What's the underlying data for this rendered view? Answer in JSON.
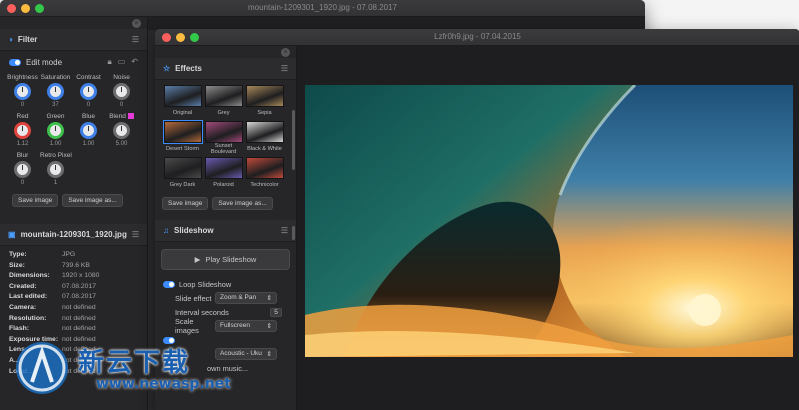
{
  "back_window": {
    "title": "mountain-1209301_1920.jpg - 07.08.2017",
    "filter": {
      "heading": "Filter",
      "edit_mode_label": "Edit mode",
      "knobs_row1": [
        {
          "label": "Brightness",
          "value": "0"
        },
        {
          "label": "Saturation",
          "value": "37"
        },
        {
          "label": "Contrast",
          "value": "0"
        },
        {
          "label": "Noise",
          "value": "0"
        }
      ],
      "knobs_row2": [
        {
          "label": "Red",
          "value": "1.12"
        },
        {
          "label": "Green",
          "value": "1.00"
        },
        {
          "label": "Blue",
          "value": "1.00"
        },
        {
          "label": "Blend",
          "value": "5.00"
        }
      ],
      "knobs_row3": [
        {
          "label": "Blur",
          "value": "0"
        },
        {
          "label": "Retro Pixel",
          "value": "1"
        }
      ],
      "save_image": "Save image",
      "save_image_as": "Save image as..."
    },
    "file_info": {
      "heading": "mountain-1209301_1920.jpg",
      "rows": [
        {
          "k": "Type:",
          "v": "JPG"
        },
        {
          "k": "Size:",
          "v": "739.6 KB"
        },
        {
          "k": "Dimensions:",
          "v": "1920 x 1080"
        },
        {
          "k": "Created:",
          "v": "07.08.2017"
        },
        {
          "k": "Last edited:",
          "v": "07.08.2017"
        },
        {
          "k": "Camera:",
          "v": "not defined"
        },
        {
          "k": "Resolution:",
          "v": "not defined"
        },
        {
          "k": "Flash:",
          "v": "not defined"
        },
        {
          "k": "Exposure time:",
          "v": "not defined"
        },
        {
          "k": "Lens:",
          "v": "not defined"
        },
        {
          "k": "A...",
          "v": "not defined"
        },
        {
          "k": "Locat...",
          "v": "not defined"
        }
      ]
    }
  },
  "front_window": {
    "title": "Lzfr0h9.jpg - 07.04.2015",
    "effects": {
      "heading": "Effects",
      "items": [
        {
          "label": "Original",
          "tint": "#5a7ea8"
        },
        {
          "label": "Grey",
          "tint": "#8c8c8c"
        },
        {
          "label": "Sepia",
          "tint": "#a8895a"
        },
        {
          "label": "Desert Storm",
          "tint": "#b36a3a"
        },
        {
          "label": "Sunset Boulevard",
          "tint": "#a24a7a"
        },
        {
          "label": "Black & White",
          "tint": "#d8d8d8"
        },
        {
          "label": "Grey Dark",
          "tint": "#4a4a4a"
        },
        {
          "label": "Polaroid",
          "tint": "#6a5ab0"
        },
        {
          "label": "Technicolor",
          "tint": "#c04a3a"
        }
      ],
      "save_image": "Save image",
      "save_image_as": "Save image as..."
    },
    "slideshow": {
      "heading": "Slideshow",
      "play_label": "Play Slideshow",
      "loop_label": "Loop Slideshow",
      "slide_effect_label": "Slide effect",
      "slide_effect_value": "Zoom & Pan",
      "interval_label": "Interval seconds",
      "interval_value": "5",
      "scale_label": "Scale images",
      "scale_value": "Fullscreen",
      "music_value": "Acoustic - Uku",
      "own_music_label": "own music..."
    }
  },
  "watermark": {
    "cn_text": "新云下载",
    "url": "www.newasp.net"
  },
  "colors": {
    "accent": "#3d8cff",
    "panel": "#262628"
  }
}
